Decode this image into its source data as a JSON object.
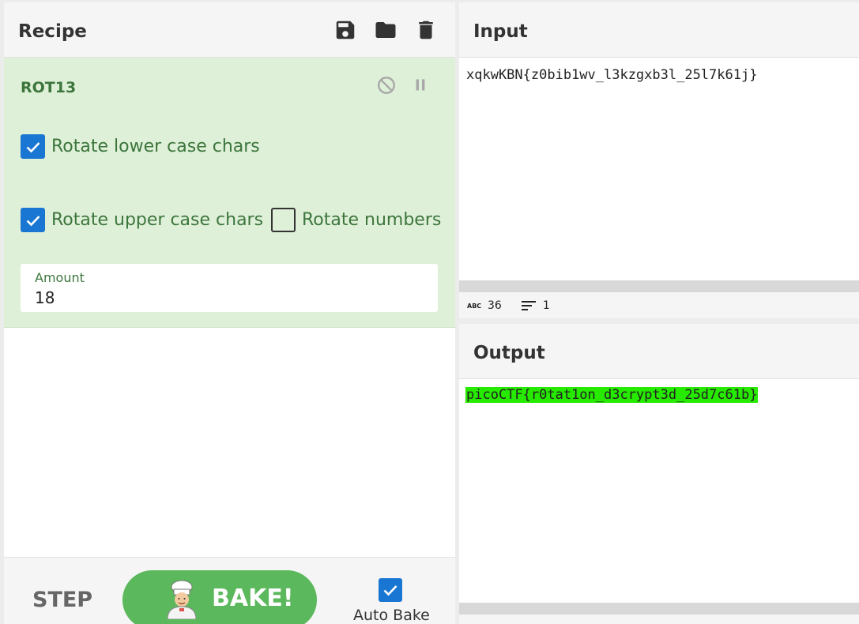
{
  "recipe": {
    "title": "Recipe",
    "icons": [
      "save-icon",
      "folder-icon",
      "trash-icon"
    ]
  },
  "operation": {
    "name": "ROT13",
    "options": {
      "rotate_lower": {
        "label": "Rotate lower case chars",
        "checked": true
      },
      "rotate_upper": {
        "label": "Rotate upper case chars",
        "checked": true
      },
      "rotate_numbers": {
        "label": "Rotate numbers",
        "checked": false
      }
    },
    "amount": {
      "label": "Amount",
      "value": "18"
    }
  },
  "controls": {
    "step_label": "STEP",
    "bake_label": "BAKE!",
    "auto_bake_label": "Auto Bake",
    "auto_bake_checked": true
  },
  "input": {
    "title": "Input",
    "value": "xqkwKBN{z0bib1wv_l3kzgxb3l_25l7k61j}",
    "stats": {
      "length": "36",
      "lines": "1"
    }
  },
  "output": {
    "title": "Output",
    "value": "picoCTF{r0tat1on_d3crypt3d_25d7c61b}",
    "highlight_color": "#26ea00"
  },
  "colors": {
    "accent": "#1976d2",
    "op_bg": "#dff0d8",
    "op_text": "#3c763d",
    "bake": "#5cb85c"
  }
}
